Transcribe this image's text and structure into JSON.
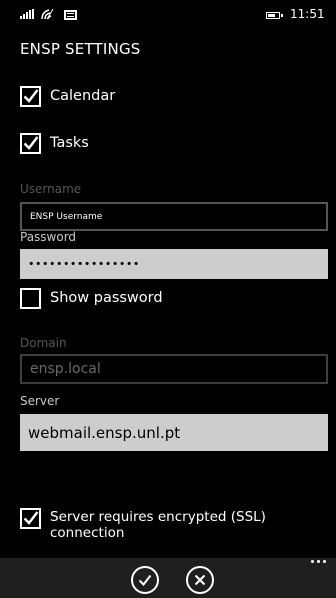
{
  "status_bar": {
    "time": "11:51",
    "icons": [
      "signal-icon",
      "wifi-icon",
      "message-icon",
      "battery-icon"
    ]
  },
  "page": {
    "title": "ENSP SETTINGS"
  },
  "sync": {
    "calendar": {
      "label": "Calendar",
      "checked": true
    },
    "tasks": {
      "label": "Tasks",
      "checked": true
    }
  },
  "username": {
    "label": "Username",
    "value": "ENSP Username"
  },
  "password": {
    "label": "Password",
    "value": "••••••••••••••••"
  },
  "show_password": {
    "label": "Show password",
    "checked": false
  },
  "domain": {
    "label": "Domain",
    "value": "ensp.local",
    "disabled": true
  },
  "server": {
    "label": "Server",
    "value": "webmail.ensp.unl.pt"
  },
  "ssl": {
    "label_line1": "Server requires encrypted (SSL)",
    "label_line2": "connection",
    "checked": true
  },
  "app_bar": {
    "buttons": [
      "check-icon",
      "close-icon",
      "more-icon"
    ]
  },
  "colors": {
    "background": "#000000",
    "app_bar": "#1f1f1f",
    "input_fill": "#cdcdcd",
    "border": "#555555",
    "label": "#c8c8c8"
  }
}
